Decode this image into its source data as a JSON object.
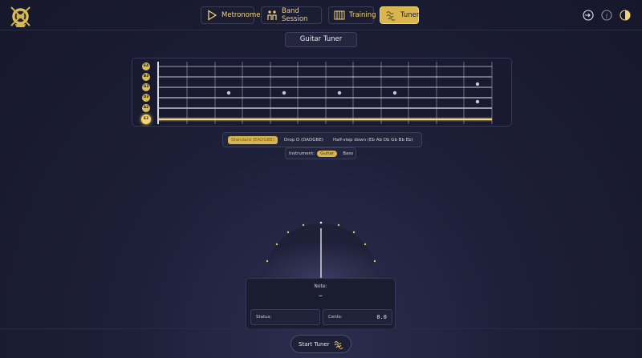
{
  "app": {
    "logo_icon": "crest-logo-icon"
  },
  "nav": {
    "items": [
      {
        "label": "Metronome",
        "icon": "play-icon",
        "active": false
      },
      {
        "label": "Band Session",
        "icon": "band-icon",
        "active": false
      },
      {
        "label": "Training",
        "icon": "training-icon",
        "active": false
      },
      {
        "label": "Tuner",
        "icon": "tuner-icon",
        "active": true
      }
    ]
  },
  "top_icons": [
    "login-icon",
    "info-icon",
    "contrast-icon"
  ],
  "page_title": "Guitar Tuner",
  "fretboard": {
    "strings": [
      {
        "note": "E4",
        "active": false
      },
      {
        "note": "B3",
        "active": false
      },
      {
        "note": "G3",
        "active": false
      },
      {
        "note": "D3",
        "active": false
      },
      {
        "note": "A2",
        "active": false
      },
      {
        "note": "E2",
        "active": true
      }
    ],
    "fret_count": 12,
    "inlay_frets": [
      3,
      5,
      7,
      9,
      12
    ]
  },
  "tunings": [
    {
      "label": "Standard (EADGBE)",
      "active": true
    },
    {
      "label": "Drop D (DADGBE)",
      "active": false
    },
    {
      "label": "Half-step down (Eb Ab Db Gb Bb Eb)",
      "active": false
    }
  ],
  "instrument": {
    "label": "Instrument:",
    "options": [
      {
        "label": "Guitar",
        "active": true
      },
      {
        "label": "Bass",
        "active": false
      }
    ]
  },
  "readout": {
    "note_label": "Note:",
    "note_value": "–",
    "status_label": "Status:",
    "status_value": "",
    "cents_label": "Cents:",
    "cents_value": "0.0"
  },
  "colors": {
    "accent": "#d8b64d",
    "background": "#1d1f38"
  },
  "start_button": {
    "label": "Start Tuner",
    "icon": "waveform-icon"
  }
}
